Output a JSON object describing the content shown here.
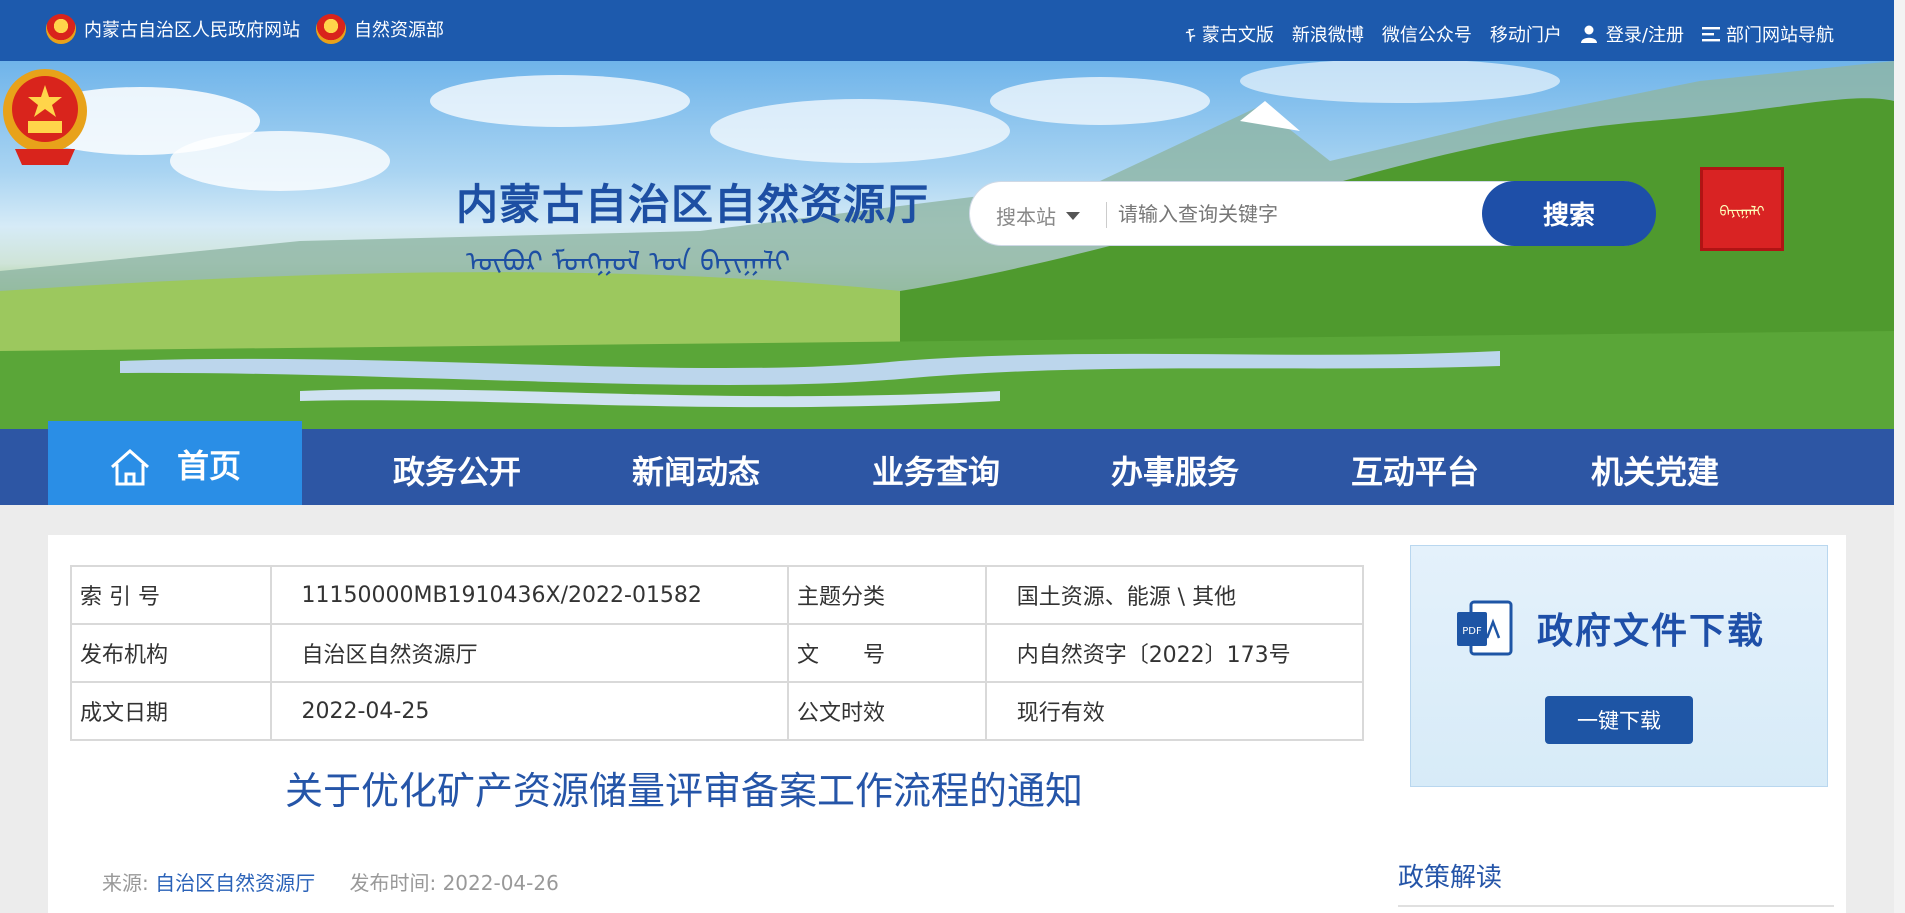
{
  "topbar": {
    "left_links": [
      {
        "label": "内蒙古自治区人民政府网站",
        "icon": "national-emblem-icon"
      },
      {
        "label": "自然资源部",
        "icon": "national-emblem-icon"
      }
    ],
    "right_links": [
      {
        "label": "蒙古文版",
        "icon": "mongolian-script-icon"
      },
      {
        "label": "新浪微博",
        "icon": ""
      },
      {
        "label": "微信公众号",
        "icon": ""
      },
      {
        "label": "移动门户",
        "icon": ""
      },
      {
        "label": "登录/注册",
        "icon": "user-icon"
      },
      {
        "label": "部门网站导航",
        "icon": "menu-icon"
      }
    ]
  },
  "header": {
    "site_title": "内蒙古自治区自然资源厅",
    "mongolian_title": "ᠥᠪᠦᠷ ᠮᠣᠩᠭᠣᠯ ᠤᠨ ᠪᠠᠶᠢᠭᠠᠯᠢ",
    "seal_text": "ᠪᠠᠶᠢᠭᠠᠯᠢ"
  },
  "search": {
    "scope": "搜本站",
    "placeholder": "请输入查询关键字",
    "button": "搜索"
  },
  "nav": {
    "home": "首页",
    "items": [
      "政务公开",
      "新闻动态",
      "业务查询",
      "办事服务",
      "互动平台",
      "机关党建"
    ]
  },
  "meta": {
    "rows": [
      [
        "索 引 号",
        "11150000MB1910436X/2022-01582",
        "主题分类",
        "国土资源、能源 \\ 其他"
      ],
      [
        "发布机构",
        "自治区自然资源厅",
        "文　　号",
        "内自然资字〔2022〕173号"
      ],
      [
        "成文日期",
        "2022-04-25",
        "公文时效",
        "现行有效"
      ]
    ]
  },
  "document": {
    "title": "关于优化矿产资源储量评审备案工作流程的通知",
    "source_label": "来源:",
    "source_value": "自治区自然资源厅",
    "publish_label": "发布时间:",
    "publish_value": "2022-04-26"
  },
  "sidebar": {
    "download_title": "政府文件下载",
    "download_button": "一键下载",
    "policy_heading": "政策解读"
  },
  "colors": {
    "brand_blue": "#1d5aad",
    "nav_blue": "#2d56a4",
    "active_tab": "#2a8ee6",
    "title_blue": "#2555a8"
  }
}
